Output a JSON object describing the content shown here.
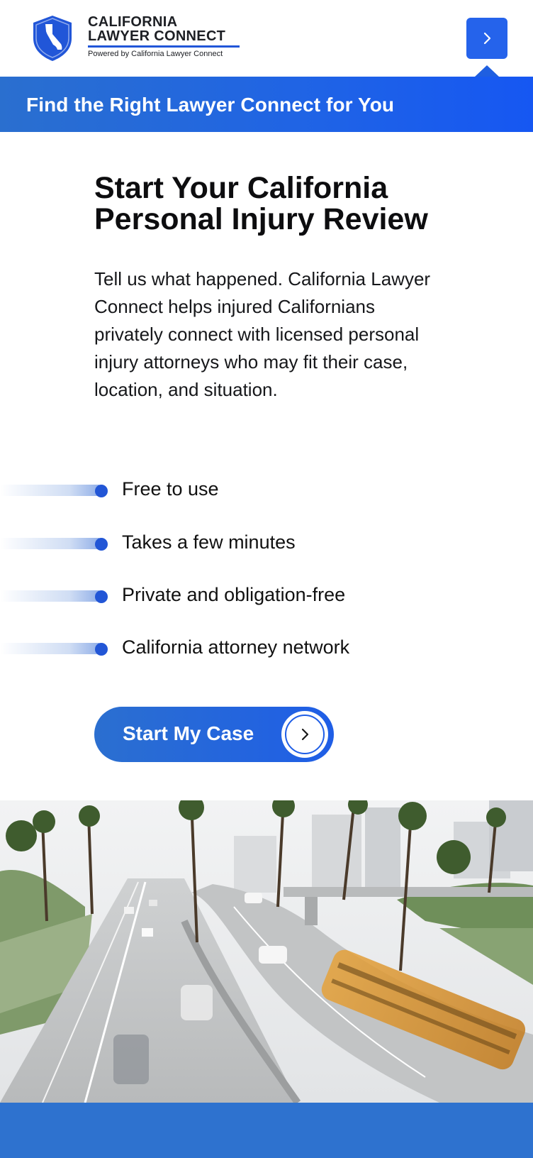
{
  "header": {
    "brand_line1": "CALIFORNIA",
    "brand_line2": "LAWYER CONNECT",
    "brand_sub": "Powered by California Lawyer Connect",
    "logo_icon": "shield-california-icon",
    "menu_icon": "chevron-right-icon"
  },
  "banner": {
    "text": "Find the Right Lawyer Connect for You"
  },
  "main": {
    "headline_line1": "Start Your California",
    "headline_line2": "Personal Injury Review",
    "intro": "Tell us what happened. California Lawyer Connect helps injured Californians privately connect with licensed personal injury attorneys who may fit their case, location, and situation.",
    "features": [
      "Free to use",
      "Takes a few minutes",
      "Private and obligation-free",
      "California attorney network"
    ],
    "cta_label": "Start My Case",
    "cta_icon": "chevron-right-icon"
  },
  "colors": {
    "accent": "#2563eb",
    "banner_start": "#2a6fcf",
    "banner_end": "#1657f2",
    "footer_band": "#2e72cf",
    "bullet": "#2256d6"
  },
  "photo": {
    "subject": "los-angeles-freeway-photo"
  }
}
